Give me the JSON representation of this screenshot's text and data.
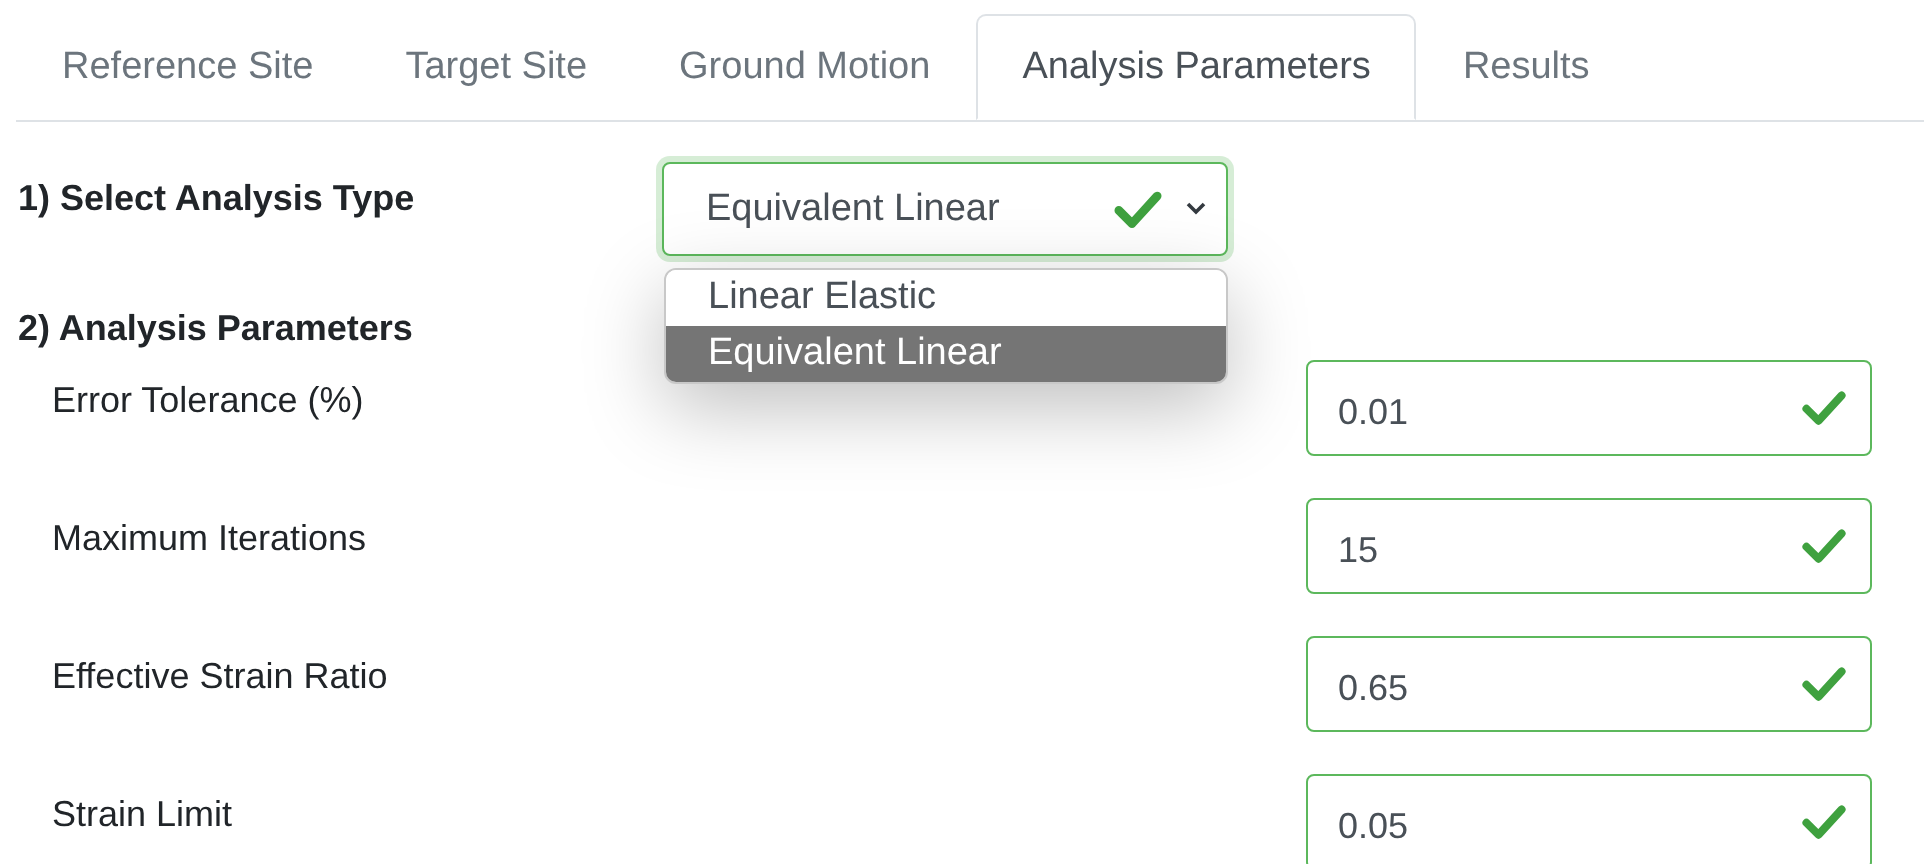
{
  "tabs": [
    {
      "label": "Reference Site",
      "selected": false
    },
    {
      "label": "Target Site",
      "selected": false
    },
    {
      "label": "Ground Motion",
      "selected": false
    },
    {
      "label": "Analysis Parameters",
      "selected": true
    },
    {
      "label": "Results",
      "selected": false
    }
  ],
  "analysis_type": {
    "heading": "1) Select Analysis Type",
    "value": "Equivalent Linear",
    "valid": true,
    "open": true,
    "options": [
      {
        "label": "Linear Elastic",
        "selected": false
      },
      {
        "label": "Equivalent Linear",
        "selected": true
      }
    ]
  },
  "parameters": {
    "heading": "2) Analysis Parameters",
    "fields": [
      {
        "label": "Error Tolerance (%)",
        "value": "0.01",
        "valid": true
      },
      {
        "label": "Maximum Iterations",
        "value": "15",
        "valid": true
      },
      {
        "label": "Effective Strain Ratio",
        "value": "0.65",
        "valid": true
      },
      {
        "label": "Strain Limit",
        "value": "0.05",
        "valid": true
      }
    ]
  }
}
